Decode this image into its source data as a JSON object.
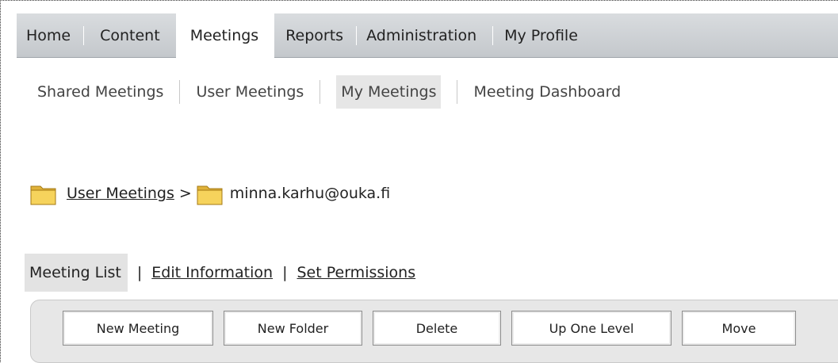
{
  "topnav": {
    "tabs": [
      {
        "label": "Home"
      },
      {
        "label": "Content"
      },
      {
        "label": "Meetings"
      },
      {
        "label": "Reports"
      },
      {
        "label": "Administration"
      },
      {
        "label": "My Profile"
      }
    ],
    "active": "Meetings"
  },
  "subnav": {
    "items": [
      {
        "label": "Shared Meetings"
      },
      {
        "label": "User Meetings"
      },
      {
        "label": "My Meetings"
      },
      {
        "label": "Meeting Dashboard"
      }
    ],
    "active": "My Meetings"
  },
  "breadcrumb": {
    "root": "User Meetings",
    "separator": ">",
    "current": "minna.karhu@ouka.fi"
  },
  "views": {
    "current": "Meeting List",
    "links": [
      {
        "label": "Edit Information"
      },
      {
        "label": "Set Permissions"
      }
    ],
    "pipe": "|"
  },
  "toolbar": {
    "buttons": [
      {
        "label": "New Meeting"
      },
      {
        "label": "New Folder"
      },
      {
        "label": "Delete"
      },
      {
        "label": "Up One Level"
      },
      {
        "label": "Move"
      }
    ]
  },
  "colors": {
    "folder": "#f2c94c",
    "nav_bg": "#cfd3d7",
    "toolbar_bg": "#e7e7e7"
  }
}
